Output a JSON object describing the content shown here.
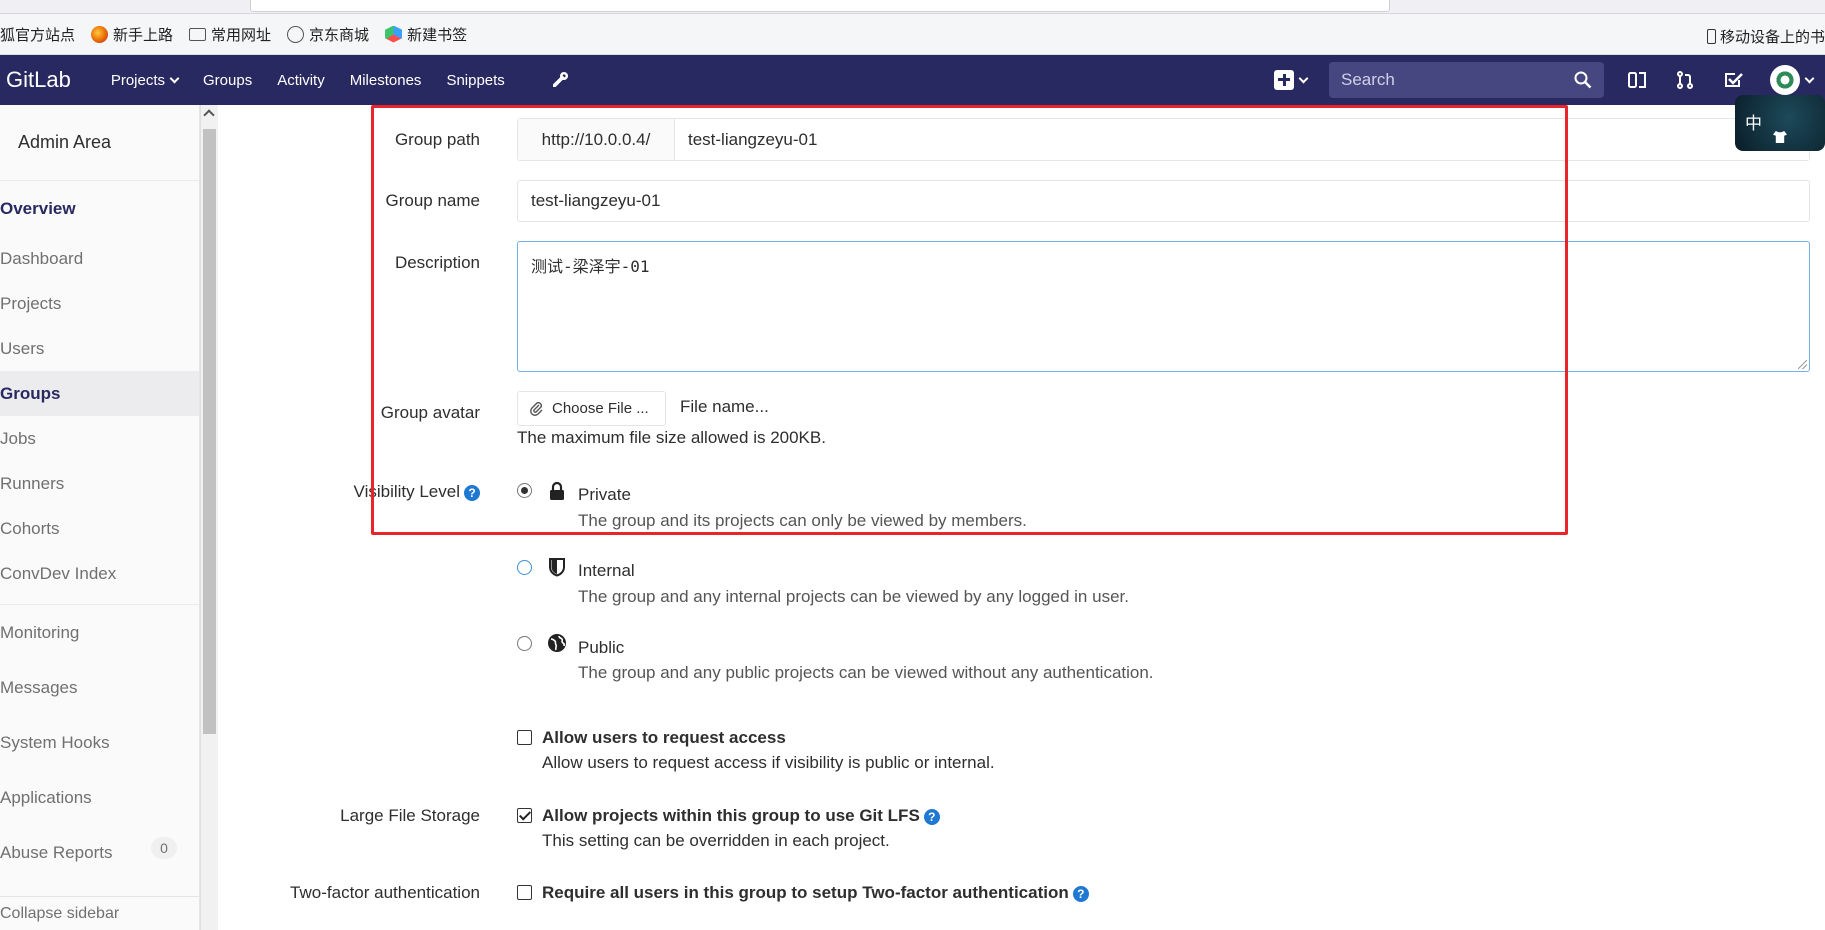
{
  "bookmarks": {
    "items": [
      {
        "label": "狐官方站点",
        "icon": "firefox-icon"
      },
      {
        "label": "新手上路",
        "icon": "firefox-icon"
      },
      {
        "label": "常用网址",
        "icon": "folder-icon"
      },
      {
        "label": "京东商城",
        "icon": "globe-icon"
      },
      {
        "label": "新建书签",
        "icon": "cube-icon"
      }
    ],
    "mobile_label": "移动设备上的书"
  },
  "navbar": {
    "logo": "GitLab",
    "links": [
      "Projects",
      "Groups",
      "Activity",
      "Milestones",
      "Snippets"
    ],
    "search_placeholder": "Search"
  },
  "sidebar": {
    "title": "Admin Area",
    "overview": "Overview",
    "sub_items": [
      "Dashboard",
      "Projects",
      "Users",
      "Groups",
      "Jobs",
      "Runners",
      "Cohorts",
      "ConvDev Index"
    ],
    "items": [
      "Monitoring",
      "Messages",
      "System Hooks",
      "Applications",
      "Abuse Reports"
    ],
    "abuse_count": "0",
    "collapse": "Collapse sidebar"
  },
  "form": {
    "group_path_label": "Group path",
    "group_path_prefix": "http://10.0.0.4/",
    "group_path_value": "test-liangzeyu-01",
    "group_name_label": "Group name",
    "group_name_value": "test-liangzeyu-01",
    "description_label": "Description",
    "description_value": "测试-梁泽宇-01",
    "avatar_label": "Group avatar",
    "choose_file": "Choose File ...",
    "file_name": "File name...",
    "max_size_help": "The maximum file size allowed is 200KB.",
    "visibility_label": "Visibility Level",
    "visibility": [
      {
        "title": "Private",
        "desc": "The group and its projects can only be viewed by members.",
        "icon": "lock-icon",
        "checked": true
      },
      {
        "title": "Internal",
        "desc": "The group and any internal projects can be viewed by any logged in user.",
        "icon": "shield-icon",
        "checked": false
      },
      {
        "title": "Public",
        "desc": "The group and any public projects can be viewed without any authentication.",
        "icon": "globe-icon",
        "checked": false
      }
    ],
    "request_access_title": "Allow users to request access",
    "request_access_desc": "Allow users to request access if visibility is public or internal.",
    "lfs_label": "Large File Storage",
    "lfs_title": "Allow projects within this group to use Git LFS",
    "lfs_desc": "This setting can be overridden in each project.",
    "tfa_label": "Two-factor authentication",
    "tfa_title": "Require all users in this group to setup Two-factor authentication"
  },
  "ime": {
    "label": "中"
  },
  "colors": {
    "navbar": "#292961",
    "highlight": "#e8252b",
    "link_blue": "#1f78d1"
  }
}
